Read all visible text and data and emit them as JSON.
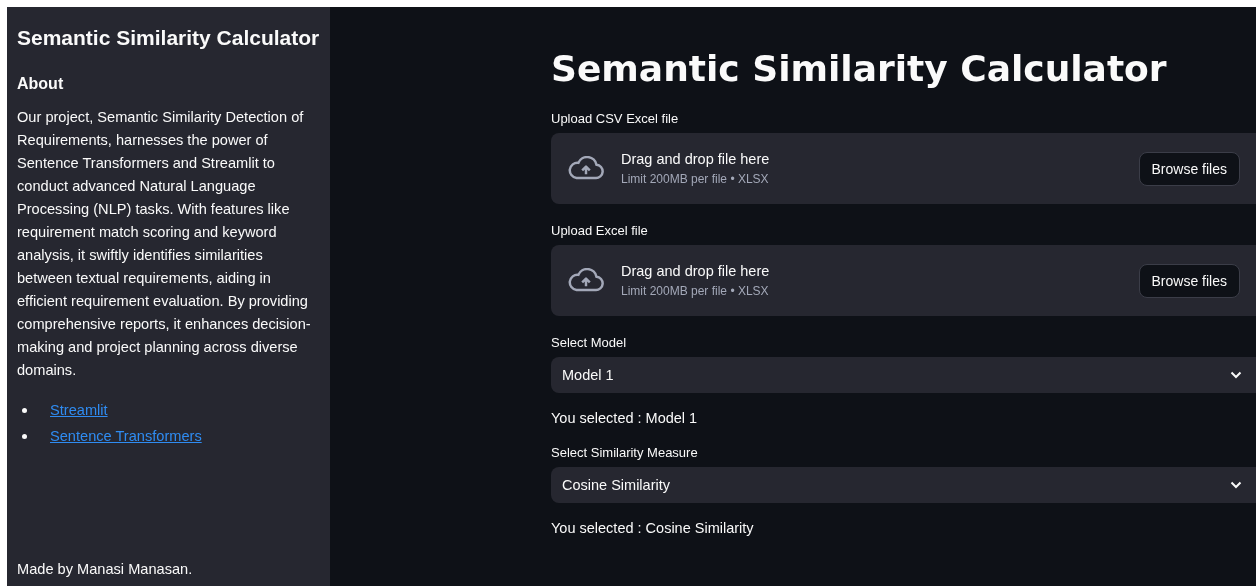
{
  "sidebar": {
    "title": "Semantic Similarity Calculator",
    "heading": "About",
    "paragraph": "Our project, Semantic Similarity Detection of Requirements, harnesses the power of Sentence Transformers and Streamlit to conduct advanced Natural Language Processing (NLP) tasks. With features like requirement match scoring and keyword analysis, it swiftly identifies similarities between textual requirements, aiding in efficient requirement evaluation. By providing comprehensive reports, it enhances decision-making and project planning across diverse domains.",
    "links": [
      "Streamlit",
      "Sentence Transformers"
    ],
    "footer": "Made by Manasi Manasan."
  },
  "main": {
    "title": "Semantic Similarity Calculator",
    "widgets": [
      {
        "kind": "upload",
        "label": "Upload CSV Excel file",
        "drop_text": "Drag and drop file here",
        "limit": "Limit 200MB per file • XLSX",
        "button": "Browse files"
      },
      {
        "kind": "upload",
        "label": "Upload Excel file",
        "drop_text": "Drag and drop file here",
        "limit": "Limit 200MB per file • XLSX",
        "button": "Browse files"
      },
      {
        "kind": "select",
        "label": "Select Model",
        "value": "Model 1",
        "result": "You selected : Model 1"
      },
      {
        "kind": "select",
        "label": "Select Similarity Measure",
        "value": "Cosine Similarity",
        "result": "You selected : Cosine Similarity"
      }
    ]
  }
}
